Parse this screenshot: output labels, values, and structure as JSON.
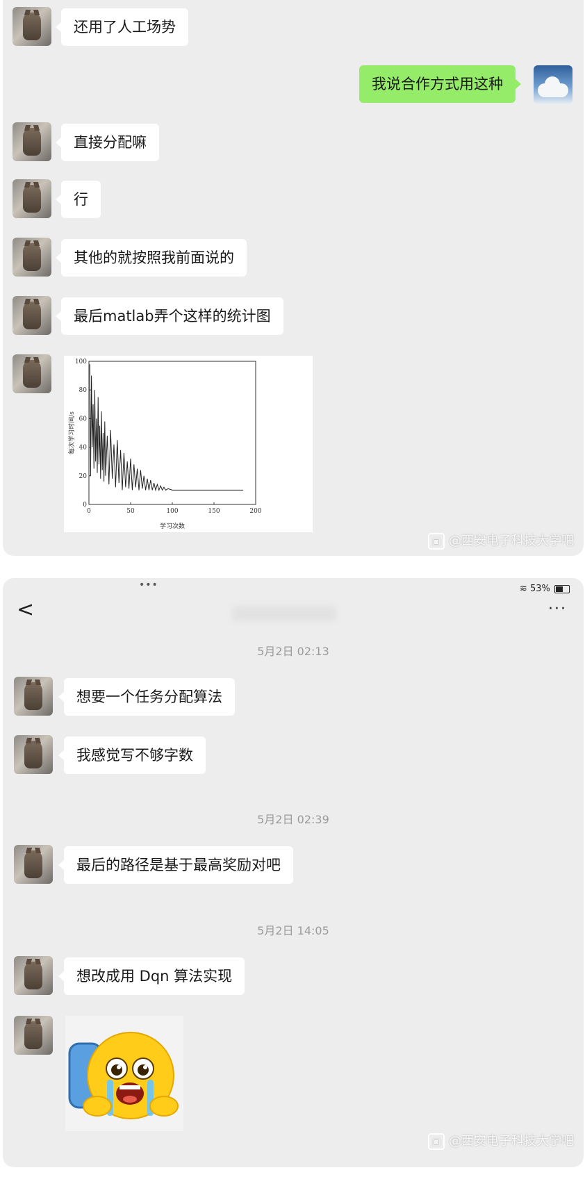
{
  "panel1": {
    "messages": [
      {
        "text": "还用了人工场势"
      },
      {
        "text": "我说合作方式用这种"
      },
      {
        "text": "直接分配嘛"
      },
      {
        "text": "行"
      },
      {
        "text": "其他的就按照我前面说的"
      },
      {
        "text": "最后matlab弄个这样的统计图"
      }
    ],
    "watermark": "@西安电子科技大学吧"
  },
  "chart_data": {
    "type": "line",
    "xlabel": "学习次数",
    "ylabel": "每次学习时间/s",
    "xlim": [
      0,
      200
    ],
    "ylim": [
      0,
      100
    ],
    "xticks": [
      "0",
      "50",
      "100",
      "150",
      "200"
    ],
    "yticks": [
      "0",
      "20",
      "40",
      "60",
      "80",
      "100"
    ],
    "series": [
      {
        "x": [
          1,
          2,
          3,
          4,
          5,
          6,
          7,
          8,
          9,
          10,
          11,
          12,
          13,
          14,
          15,
          16,
          17,
          18,
          19,
          20,
          22,
          24,
          26,
          28,
          30,
          32,
          34,
          36,
          38,
          40,
          42,
          44,
          46,
          48,
          50,
          52,
          54,
          56,
          58,
          60,
          62,
          64,
          66,
          68,
          70,
          72,
          74,
          76,
          78,
          80,
          82,
          84,
          86,
          88,
          90,
          92,
          95,
          100,
          110,
          120,
          130,
          140,
          150,
          160,
          170,
          180,
          185
        ],
        "y": [
          98,
          20,
          90,
          40,
          70,
          25,
          80,
          30,
          60,
          22,
          75,
          28,
          55,
          18,
          65,
          24,
          50,
          16,
          58,
          20,
          48,
          14,
          52,
          18,
          42,
          12,
          45,
          15,
          38,
          10,
          36,
          12,
          30,
          11,
          32,
          10,
          28,
          12,
          25,
          10,
          24,
          11,
          20,
          10,
          18,
          10,
          17,
          10,
          15,
          10,
          14,
          10,
          13,
          10,
          12,
          10,
          11,
          10,
          10,
          10,
          10,
          10,
          10,
          10,
          10,
          10,
          10
        ]
      }
    ]
  },
  "panel2": {
    "status": {
      "battery": "53%"
    },
    "nav": {
      "back": "<",
      "more": "···"
    },
    "timestamps": [
      "5月2日 02:13",
      "5月2日 02:39",
      "5月2日 14:05"
    ],
    "messages": [
      {
        "text": "想要一个任务分配算法"
      },
      {
        "text": "我感觉写不够字数"
      },
      {
        "text": "最后的路径是基于最高奖励对吧"
      },
      {
        "text": "想改成用 Dqn 算法实现"
      }
    ],
    "watermark": "@西安电子科技大学吧"
  }
}
